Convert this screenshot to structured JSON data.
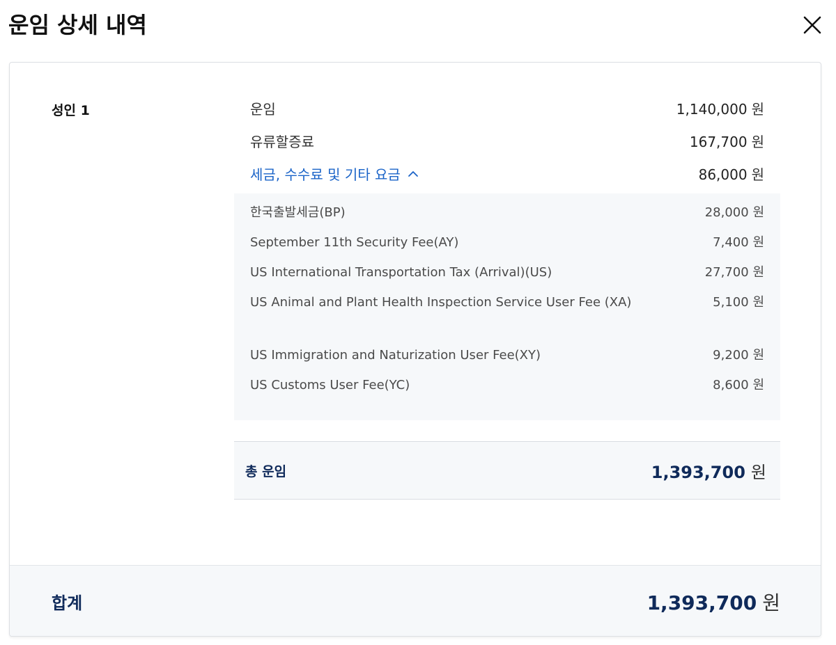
{
  "header": {
    "title": "운임 상세 내역"
  },
  "passenger": {
    "label": "성인 1"
  },
  "currency_unit": "원",
  "fares": {
    "base": {
      "label": "운임",
      "amount": "1,140,000"
    },
    "fuel": {
      "label": "유류할증료",
      "amount": "167,700"
    },
    "taxes": {
      "label": "세금, 수수료 및 기타 요금",
      "amount": "86,000",
      "expanded": true
    }
  },
  "tax_items": [
    {
      "name": "한국출발세금(BP)",
      "amount": "28,000"
    },
    {
      "name": "September 11th Security Fee(AY)",
      "amount": "7,400"
    },
    {
      "name": "US International Transportation Tax (Arrival)(US)",
      "amount": "27,700"
    },
    {
      "name": "US Animal and Plant Health Inspection Service User Fee (XA)",
      "amount": "5,100"
    },
    {
      "name": "US Immigration and Naturization User Fee(XY)",
      "amount": "9,200"
    },
    {
      "name": "US Customs User Fee(YC)",
      "amount": "8,600"
    }
  ],
  "total_fare": {
    "label": "총 운임",
    "amount": "1,393,700"
  },
  "grand_total": {
    "label": "합계",
    "amount": "1,393,700"
  },
  "colors": {
    "link": "#1b64c8",
    "total_text": "#0f2a5a",
    "panel_bg": "#f6f8fa"
  },
  "icons": {
    "close": "close-icon",
    "caret": "chevron-up-icon"
  }
}
